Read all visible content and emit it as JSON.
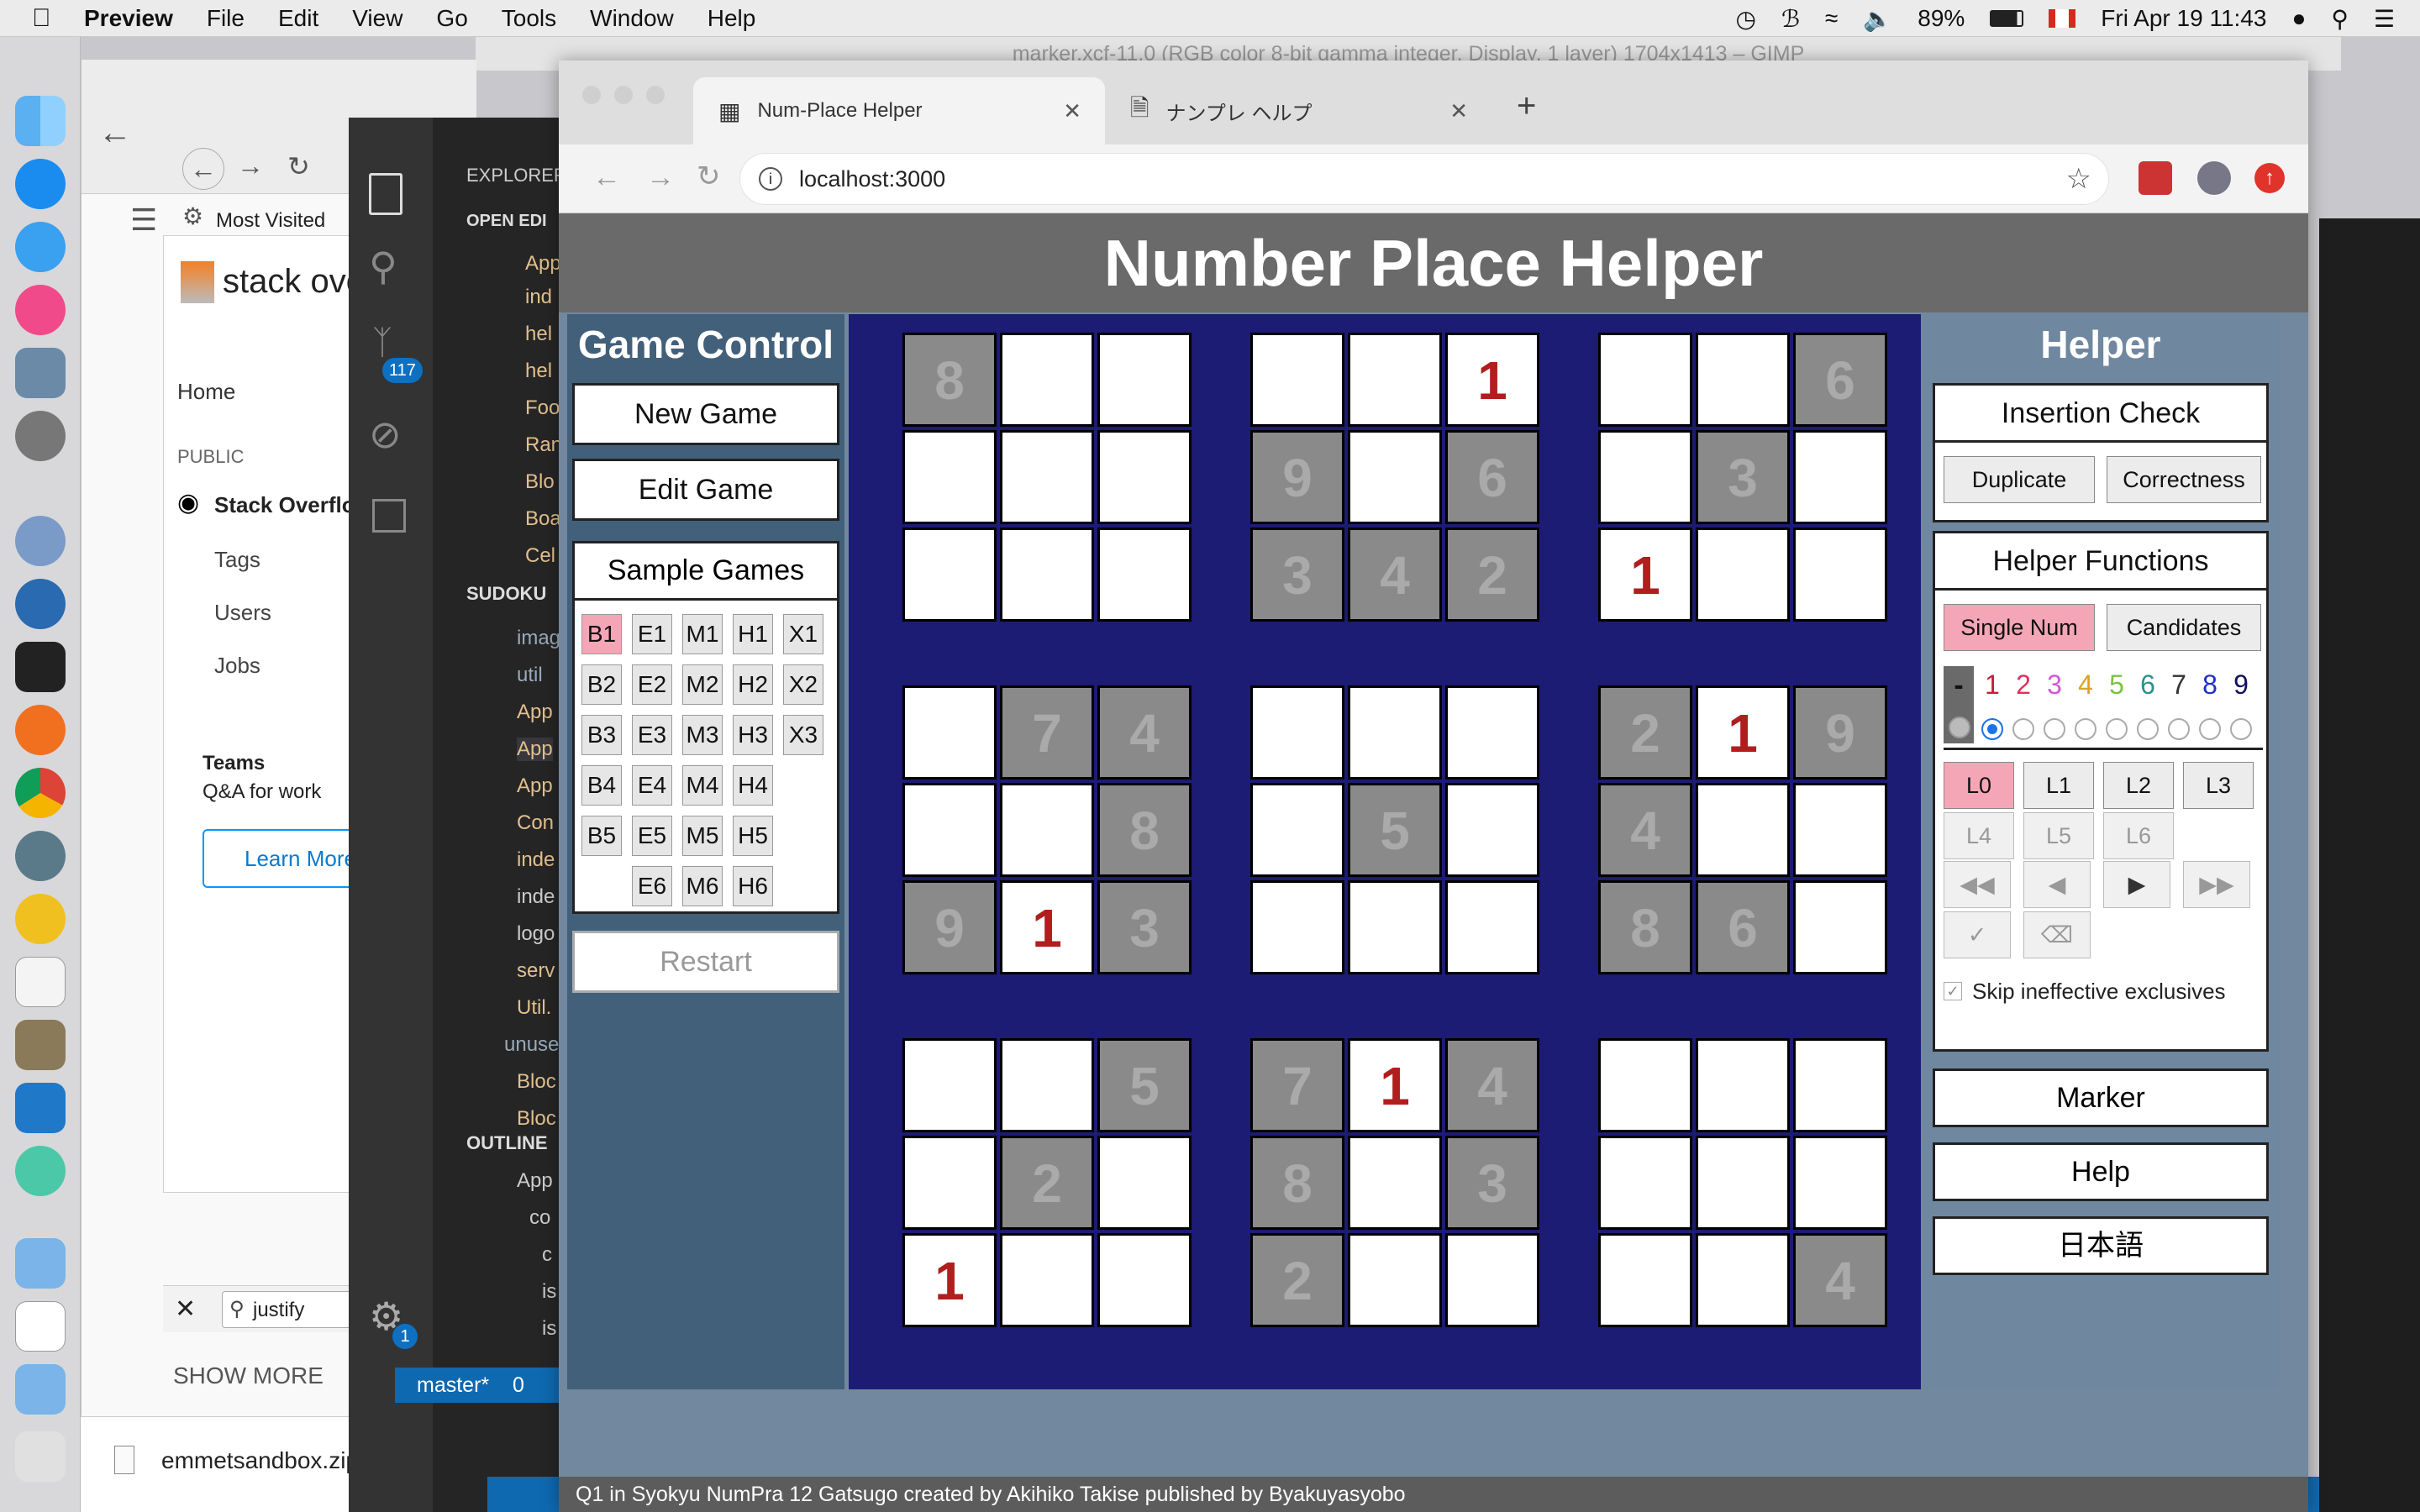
{
  "menubar": {
    "app": "Preview",
    "items": [
      "File",
      "Edit",
      "View",
      "Go",
      "Tools",
      "Window",
      "Help"
    ],
    "battery": "89%",
    "datetime": "Fri Apr 19  11:43"
  },
  "gimp_title": "marker.xcf-11.0 (RGB color 8-bit gamma integer, Display, 1 layer) 1704x1413 – GIMP",
  "firefox": {
    "most_visited": "Most Visited",
    "so_logo": "stack ove",
    "nav": [
      "Home",
      "PUBLIC",
      "Stack Overflo",
      "Tags",
      "Users",
      "Jobs"
    ],
    "teams_title": "Teams",
    "teams_sub": "Q&A for work",
    "learn_more": "Learn More",
    "find": "justify",
    "show_more": "SHOW MORE"
  },
  "download": {
    "file": "emmetsandbox.zip"
  },
  "vscode": {
    "explorer": "EXPLORER",
    "open_editors": "OPEN EDI",
    "sudoku": "SUDOKU",
    "outline": "OUTLINE",
    "scm_badge": "117",
    "files": [
      "App",
      "ind",
      "hel",
      "hel",
      "Foo",
      "Ran",
      "Blo",
      "Boa",
      "Cel"
    ],
    "tree": [
      "imag",
      "util",
      "App",
      "App",
      "App",
      "Con",
      "inde",
      "inde",
      "logo",
      "serv",
      "Util.",
      "unuse",
      "Bloc",
      "Bloc"
    ],
    "outline_items": [
      "App",
      "co",
      "c",
      "is",
      "is"
    ],
    "branch": "master*",
    "errors": "0",
    "gear_badge": "1"
  },
  "browser": {
    "tabs": [
      {
        "title": "Num-Place Helper"
      },
      {
        "title": "ナンプレ ヘルプ"
      }
    ],
    "url": "localhost:3000"
  },
  "app": {
    "title": "Number Place Helper",
    "game_control": {
      "title": "Game Control",
      "new_game": "New Game",
      "edit_game": "Edit Game",
      "sample_games": "Sample Games",
      "samples": [
        [
          "B1",
          "E1",
          "M1",
          "H1",
          "X1"
        ],
        [
          "B2",
          "E2",
          "M2",
          "H2",
          "X2"
        ],
        [
          "B3",
          "E3",
          "M3",
          "H3",
          "X3"
        ],
        [
          "B4",
          "E4",
          "M4",
          "H4",
          ""
        ],
        [
          "B5",
          "E5",
          "M5",
          "H5",
          ""
        ],
        [
          "",
          "E6",
          "M6",
          "H6",
          ""
        ]
      ],
      "selected_sample": "B1",
      "restart": "Restart"
    },
    "board": [
      [
        {
          "v": "8",
          "t": "g"
        },
        {
          "v": "",
          "t": ""
        },
        {
          "v": "",
          "t": ""
        },
        {
          "v": "",
          "t": ""
        },
        {
          "v": "",
          "t": ""
        },
        {
          "v": "1",
          "t": "p"
        },
        {
          "v": "",
          "t": ""
        },
        {
          "v": "",
          "t": ""
        },
        {
          "v": "6",
          "t": "g"
        }
      ],
      [
        {
          "v": "",
          "t": ""
        },
        {
          "v": "",
          "t": ""
        },
        {
          "v": "",
          "t": ""
        },
        {
          "v": "9",
          "t": "g"
        },
        {
          "v": "",
          "t": ""
        },
        {
          "v": "6",
          "t": "g"
        },
        {
          "v": "",
          "t": ""
        },
        {
          "v": "3",
          "t": "g"
        },
        {
          "v": "",
          "t": ""
        }
      ],
      [
        {
          "v": "",
          "t": ""
        },
        {
          "v": "",
          "t": ""
        },
        {
          "v": "",
          "t": ""
        },
        {
          "v": "3",
          "t": "g"
        },
        {
          "v": "4",
          "t": "g"
        },
        {
          "v": "2",
          "t": "g"
        },
        {
          "v": "1",
          "t": "p"
        },
        {
          "v": "",
          "t": ""
        },
        {
          "v": "",
          "t": ""
        }
      ],
      [
        {
          "v": "",
          "t": ""
        },
        {
          "v": "7",
          "t": "g"
        },
        {
          "v": "4",
          "t": "g"
        },
        {
          "v": "",
          "t": ""
        },
        {
          "v": "",
          "t": ""
        },
        {
          "v": "",
          "t": ""
        },
        {
          "v": "2",
          "t": "g"
        },
        {
          "v": "1",
          "t": "p"
        },
        {
          "v": "9",
          "t": "g"
        }
      ],
      [
        {
          "v": "",
          "t": ""
        },
        {
          "v": "",
          "t": ""
        },
        {
          "v": "8",
          "t": "g"
        },
        {
          "v": "",
          "t": ""
        },
        {
          "v": "5",
          "t": "g"
        },
        {
          "v": "",
          "t": ""
        },
        {
          "v": "4",
          "t": "g"
        },
        {
          "v": "",
          "t": ""
        },
        {
          "v": "",
          "t": ""
        }
      ],
      [
        {
          "v": "9",
          "t": "g"
        },
        {
          "v": "1",
          "t": "p"
        },
        {
          "v": "3",
          "t": "g"
        },
        {
          "v": "",
          "t": ""
        },
        {
          "v": "",
          "t": ""
        },
        {
          "v": "",
          "t": ""
        },
        {
          "v": "8",
          "t": "g"
        },
        {
          "v": "6",
          "t": "g"
        },
        {
          "v": "",
          "t": ""
        }
      ],
      [
        {
          "v": "",
          "t": ""
        },
        {
          "v": "",
          "t": ""
        },
        {
          "v": "5",
          "t": "g"
        },
        {
          "v": "7",
          "t": "g"
        },
        {
          "v": "1",
          "t": "p"
        },
        {
          "v": "4",
          "t": "g"
        },
        {
          "v": "",
          "t": ""
        },
        {
          "v": "",
          "t": ""
        },
        {
          "v": "",
          "t": ""
        }
      ],
      [
        {
          "v": "",
          "t": ""
        },
        {
          "v": "2",
          "t": "g"
        },
        {
          "v": "",
          "t": ""
        },
        {
          "v": "8",
          "t": "g"
        },
        {
          "v": "",
          "t": ""
        },
        {
          "v": "3",
          "t": "g"
        },
        {
          "v": "",
          "t": ""
        },
        {
          "v": "",
          "t": ""
        },
        {
          "v": "",
          "t": ""
        }
      ],
      [
        {
          "v": "1",
          "t": "p"
        },
        {
          "v": "",
          "t": ""
        },
        {
          "v": "",
          "t": ""
        },
        {
          "v": "2",
          "t": "g"
        },
        {
          "v": "",
          "t": ""
        },
        {
          "v": "",
          "t": ""
        },
        {
          "v": "",
          "t": ""
        },
        {
          "v": "",
          "t": ""
        },
        {
          "v": "4",
          "t": "g"
        }
      ]
    ],
    "helper": {
      "title": "Helper",
      "insertion_check": "Insertion Check",
      "duplicate": "Duplicate",
      "correctness": "Correctness",
      "helper_functions": "Helper Functions",
      "single_num": "Single Num",
      "candidates": "Candidates",
      "dash": "-",
      "digits": [
        "1",
        "2",
        "3",
        "4",
        "5",
        "6",
        "7",
        "8",
        "9"
      ],
      "digit_colors": [
        "#c41e3a",
        "#e0305a",
        "#d257d6",
        "#d9a520",
        "#7cc243",
        "#2f8f8f",
        "#333333",
        "#2030c8",
        "#101060"
      ],
      "levels": [
        "L0",
        "L1",
        "L2",
        "L3",
        "L4",
        "L5",
        "L6"
      ],
      "selected_level": "L0",
      "skip_label": "Skip ineffective exclusives",
      "marker": "Marker",
      "help": "Help",
      "language": "日本語"
    },
    "footer": "Q1 in Syokyu NumPra 12 Gatsugo created by Akihiko Takise published by Byakuyasyobo"
  }
}
